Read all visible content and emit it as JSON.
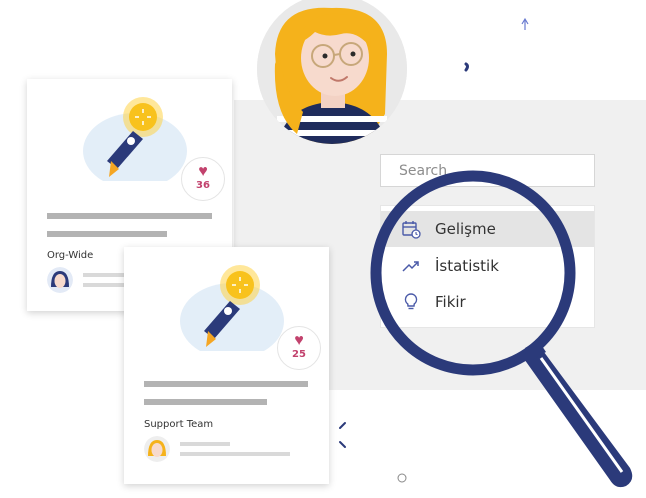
{
  "search": {
    "placeholder": "Search"
  },
  "menu": {
    "items": [
      {
        "label": "Gelişme",
        "icon": "calendar-clock-icon",
        "selected": true
      },
      {
        "label": "İstatistik",
        "icon": "trend-up-icon",
        "selected": false
      },
      {
        "label": "Fikir",
        "icon": "lightbulb-icon",
        "selected": false
      }
    ]
  },
  "cards": [
    {
      "team": "Org-Wide",
      "likes": "36"
    },
    {
      "team": "Support Team",
      "likes": "25"
    }
  ],
  "colors": {
    "accent_navy": "#2b3a7a",
    "heart": "#c2426d",
    "rocket_glow": "#ffd447",
    "hair": "#f5b21b"
  }
}
